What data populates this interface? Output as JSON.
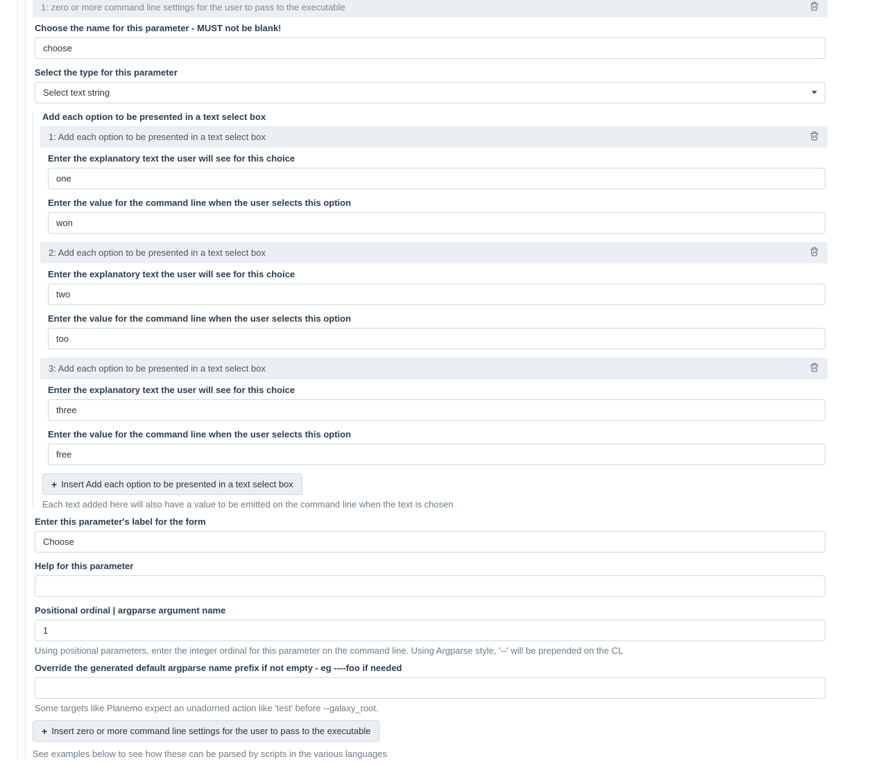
{
  "top_header": "1: zero or more command line settings for the user to pass to the executable",
  "param_name": {
    "label": "Choose the name for this parameter - MUST not be blank!",
    "value": "choose"
  },
  "param_type": {
    "label": "Select the type for this parameter",
    "value": "Select text string"
  },
  "options_section": {
    "label": "Add each option to be presented in a text select box",
    "items": [
      {
        "header": "1: Add each option to be presented in a text select box",
        "text_label": "Enter the explanatory text the user will see for this choice",
        "text_value": "one",
        "value_label": "Enter the value for the command line when the user selects this option",
        "value_value": "won"
      },
      {
        "header": "2: Add each option to be presented in a text select box",
        "text_label": "Enter the explanatory text the user will see for this choice",
        "text_value": "two",
        "value_label": "Enter the value for the command line when the user selects this option",
        "value_value": "too"
      },
      {
        "header": "3: Add each option to be presented in a text select box",
        "text_label": "Enter the explanatory text the user will see for this choice",
        "text_value": "three",
        "value_label": "Enter the value for the command line when the user selects this option",
        "value_value": "free"
      }
    ],
    "insert_button": "Insert Add each option to be presented in a text select box",
    "help": "Each text added here will also have a value to be emitted on the command line when the text is chosen"
  },
  "param_label": {
    "label": "Enter this parameter's label for the form",
    "value": "Choose"
  },
  "param_help": {
    "label": "Help for this parameter",
    "value": ""
  },
  "ordinal": {
    "label": "Positional ordinal | argparse argument name",
    "value": "1",
    "help": "Using positional parameters, enter the integer ordinal for this parameter on the command line. Using Argparse style, '--' will be prepended on the CL"
  },
  "override": {
    "label": "Override the generated default argparse name prefix if not empty - eg ----foo if needed",
    "value": "",
    "help": "Some targets like Planemo expect an unadorned action like 'test' before --galaxy_root."
  },
  "outer_insert_button": "Insert zero or more command line settings for the user to pass to the executable",
  "footer_help": "See examples below to see how these can be parsed by scripts in the various languages"
}
